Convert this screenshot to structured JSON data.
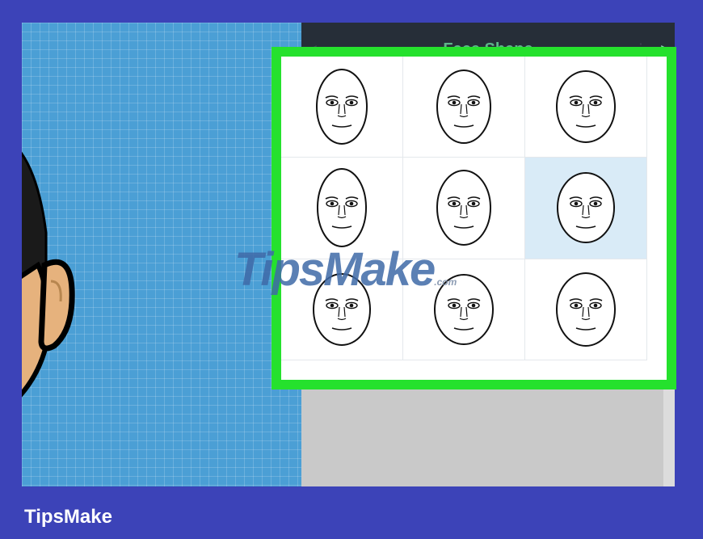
{
  "panel": {
    "title": "Face Shape",
    "nav_prev_icon": "left-arrow-icon",
    "nav_next_icon": "right-arrow-icon",
    "options": [
      {
        "shape": "oval"
      },
      {
        "shape": "rounded"
      },
      {
        "shape": "wide"
      },
      {
        "shape": "oval-long"
      },
      {
        "shape": "egg"
      },
      {
        "shape": "round"
      },
      {
        "shape": "square"
      },
      {
        "shape": "square-wide"
      },
      {
        "shape": "wide-oval"
      }
    ],
    "selected_index": 5
  },
  "colors": {
    "highlight_border": "#25e12d",
    "panel_header": "#262e38",
    "title_text": "#5fb58a",
    "selected_cell": "#d9ebf7",
    "canvas": "#4b9fd5",
    "page_background": "#3c43b8"
  },
  "watermark": {
    "main": "TipsMake",
    "suffix": ".com"
  },
  "footer": {
    "brand": "TipsMake"
  }
}
